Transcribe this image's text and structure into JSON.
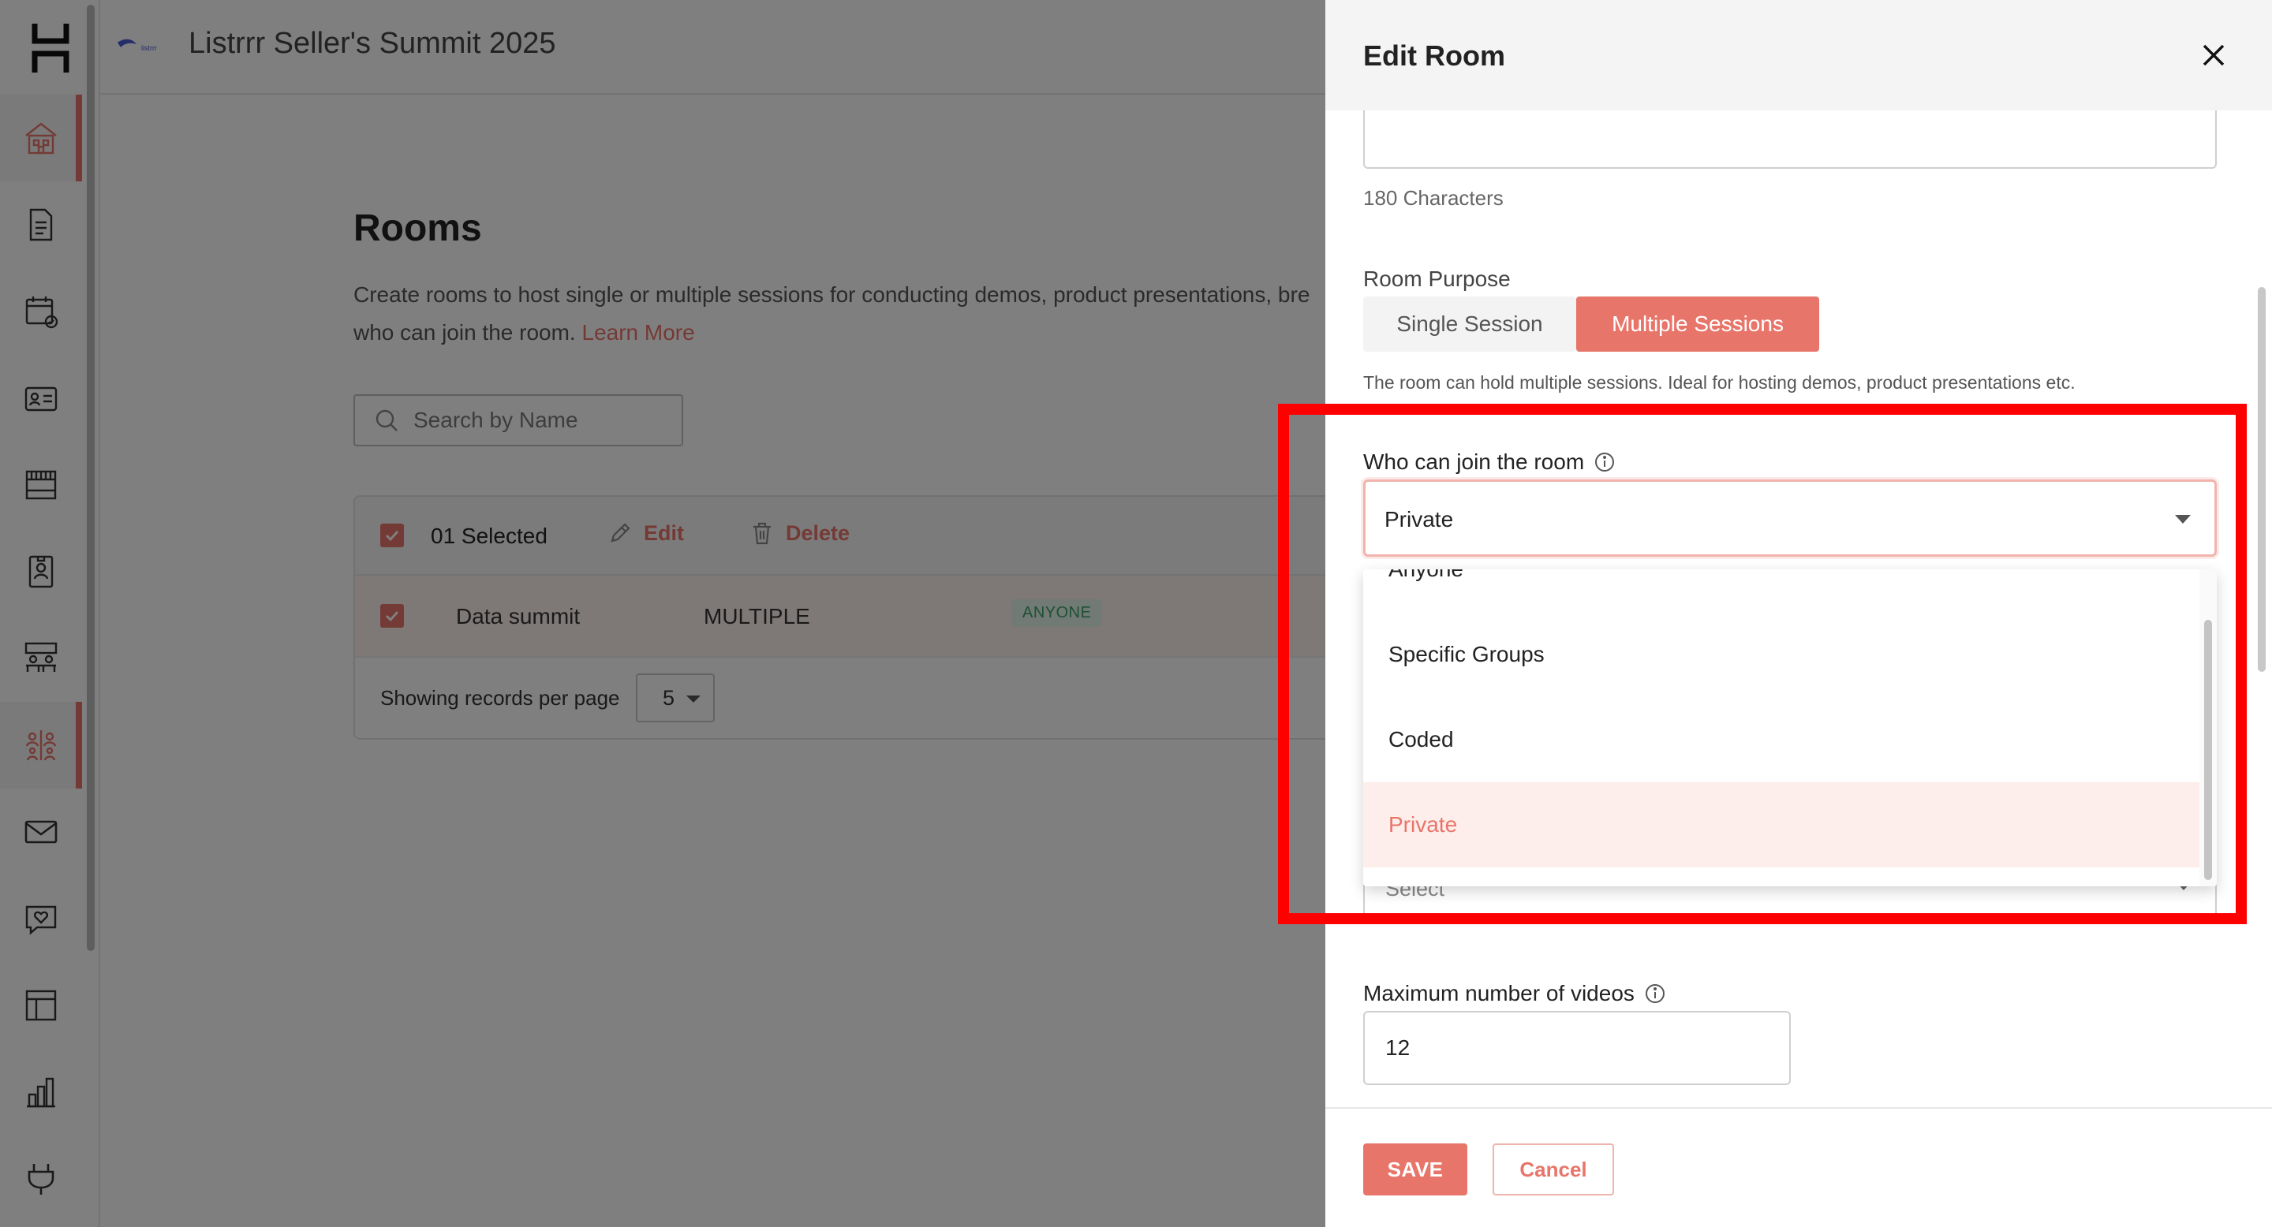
{
  "header": {
    "event_title": "Listrrr Seller's Summit 2025",
    "brand_text": "listrrr"
  },
  "sidebar": {
    "items": [
      {
        "icon": "home-icon",
        "active": true
      },
      {
        "icon": "document-icon"
      },
      {
        "icon": "calendar-check-icon"
      },
      {
        "icon": "contact-card-icon"
      },
      {
        "icon": "booth-icon"
      },
      {
        "icon": "badge-icon"
      },
      {
        "icon": "lounge-icon"
      },
      {
        "icon": "rooms-icon",
        "active": true
      },
      {
        "icon": "mail-icon"
      },
      {
        "icon": "chat-heart-icon"
      },
      {
        "icon": "layout-icon"
      },
      {
        "icon": "analytics-icon"
      },
      {
        "icon": "integrations-icon"
      }
    ]
  },
  "main": {
    "title": "Rooms",
    "description": "Create rooms to host single or multiple sessions for conducting demos, product presentations, bre",
    "description_line2": "who can join the room.",
    "learn_more": "Learn More",
    "search_placeholder": "Search by Name",
    "table": {
      "selected_text": "01 Selected",
      "edit_label": "Edit",
      "delete_label": "Delete",
      "rows": [
        {
          "name": "Data summit",
          "type": "MULTIPLE",
          "access": "ANYONE"
        }
      ],
      "pager_label": "Showing records per page",
      "pager_value": "5"
    }
  },
  "drawer": {
    "title": "Edit Room",
    "char_count": "180 Characters",
    "purpose_label": "Room Purpose",
    "purpose_options": [
      "Single Session",
      "Multiple Sessions"
    ],
    "purpose_selected": "Multiple Sessions",
    "purpose_hint": "The room can hold multiple sessions. Ideal for hosting demos, product presentations etc.",
    "who_label": "Who can join the room",
    "who_value": "Private",
    "who_options": [
      "Anyone",
      "Specific Groups",
      "Coded",
      "Private"
    ],
    "select_placeholder": "Select",
    "max_videos_label": "Maximum number of videos",
    "max_videos_value": "12",
    "save_label": "SAVE",
    "cancel_label": "Cancel"
  },
  "colors": {
    "accent": "#e8756a",
    "highlight": "#ff0000",
    "badge_green": "#3aa16a"
  }
}
